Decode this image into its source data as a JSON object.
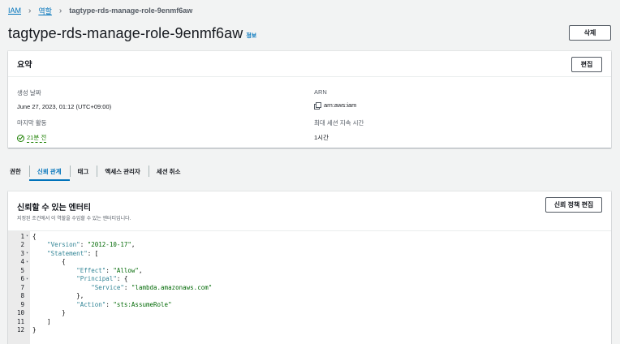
{
  "breadcrumb": {
    "root": "IAM",
    "section": "역할",
    "current": "tagtype-rds-manage-role-9enmf6aw"
  },
  "header": {
    "title": "tagtype-rds-manage-role-9enmf6aw",
    "info_label": "정보",
    "delete_label": "삭제"
  },
  "summary": {
    "title": "요약",
    "edit_label": "편집",
    "created_label": "생성 날짜",
    "created_value": "June 27, 2023, 01:12 (UTC+09:00)",
    "arn_label": "ARN",
    "arn_value": "arn:aws:iam",
    "last_activity_label": "마지막 활동",
    "last_activity_value": "21분 전",
    "max_session_label": "최대 세션 지속 시간",
    "max_session_value": "1시간"
  },
  "tabs": [
    {
      "label": "권한",
      "active": false
    },
    {
      "label": "신뢰 관계",
      "active": true
    },
    {
      "label": "태그",
      "active": false
    },
    {
      "label": "액세스 관리자",
      "active": false
    },
    {
      "label": "세션 취소",
      "active": false
    }
  ],
  "trust": {
    "title": "신뢰할 수 있는 엔터티",
    "description": "지정된 조건에서 이 역할을 수임할 수 있는 엔터티입니다.",
    "edit_policy_label": "신뢰 정책 편집",
    "code_lines": [
      {
        "n": "1",
        "fold": true,
        "text": "{"
      },
      {
        "n": "2",
        "fold": false,
        "text": "    \"Version\": \"2012-10-17\","
      },
      {
        "n": "3",
        "fold": true,
        "text": "    \"Statement\": ["
      },
      {
        "n": "4",
        "fold": true,
        "text": "        {"
      },
      {
        "n": "5",
        "fold": false,
        "text": "            \"Effect\": \"Allow\","
      },
      {
        "n": "6",
        "fold": true,
        "text": "            \"Principal\": {"
      },
      {
        "n": "7",
        "fold": false,
        "text": "                \"Service\": \"lambda.amazonaws.com\""
      },
      {
        "n": "8",
        "fold": false,
        "text": "            },"
      },
      {
        "n": "9",
        "fold": false,
        "text": "            \"Action\": \"sts:AssumeRole\""
      },
      {
        "n": "10",
        "fold": false,
        "text": "        }"
      },
      {
        "n": "11",
        "fold": false,
        "text": "    ]"
      },
      {
        "n": "12",
        "fold": false,
        "text": "}"
      }
    ]
  },
  "colors": {
    "link": "#0073bb",
    "success": "#1d8102",
    "background": "#f2f3f3"
  }
}
